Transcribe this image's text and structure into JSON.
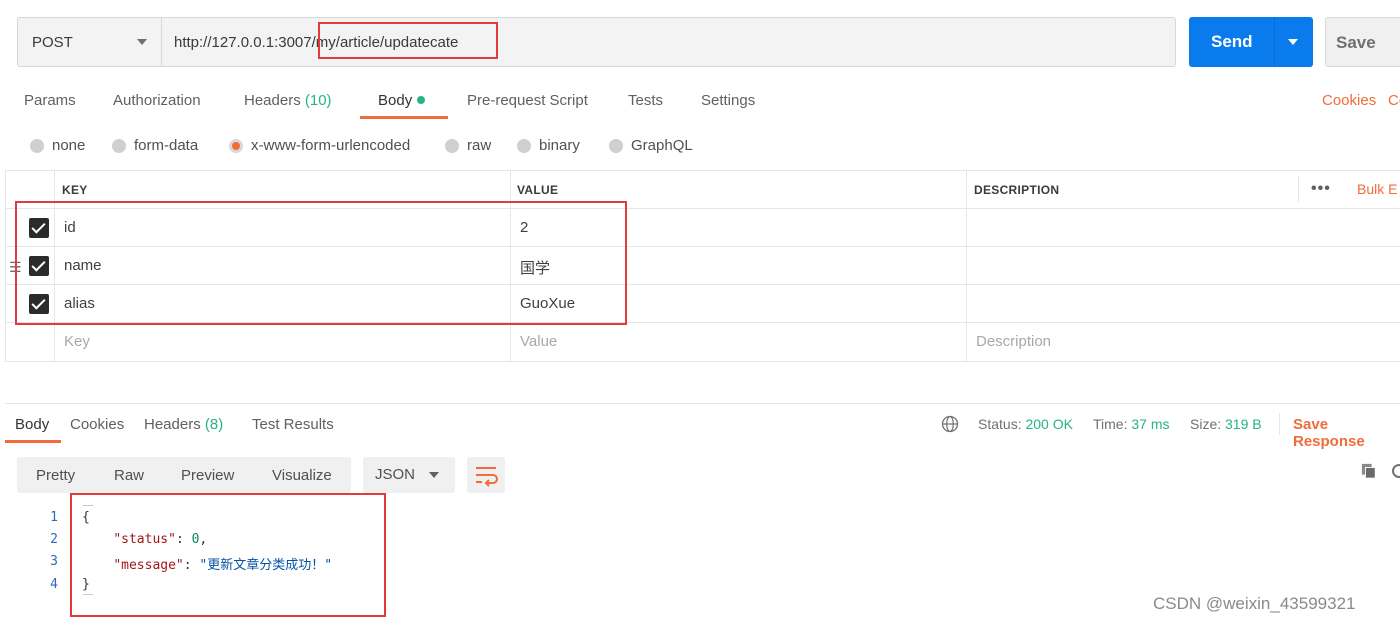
{
  "request": {
    "method": "POST",
    "url": "http://127.0.0.1:3007/my/article/updatecate",
    "send_label": "Send",
    "save_label": "Save"
  },
  "request_tabs": {
    "params": "Params",
    "authorization": "Authorization",
    "headers": "Headers",
    "headers_count": "(10)",
    "body": "Body",
    "prerequest": "Pre-request Script",
    "tests": "Tests",
    "settings": "Settings",
    "cookies": "Cookies",
    "cookies_clipped": "Co"
  },
  "body_types": [
    "none",
    "form-data",
    "x-www-form-urlencoded",
    "raw",
    "binary",
    "GraphQL"
  ],
  "body_type_selected": "x-www-form-urlencoded",
  "params_table": {
    "headers": {
      "key": "KEY",
      "value": "VALUE",
      "description": "DESCRIPTION"
    },
    "bulk_edit": "Bulk E",
    "rows": [
      {
        "key": "id",
        "value": "2",
        "checked": true
      },
      {
        "key": "name",
        "value": "国学",
        "checked": true
      },
      {
        "key": "alias",
        "value": "GuoXue",
        "checked": true
      }
    ],
    "placeholder": {
      "key": "Key",
      "value": "Value",
      "description": "Description"
    }
  },
  "response_tabs": {
    "body": "Body",
    "cookies": "Cookies",
    "headers": "Headers",
    "headers_count": "(8)",
    "test_results": "Test Results"
  },
  "response_status": {
    "status_label": "Status:",
    "status_value": "200 OK",
    "time_label": "Time:",
    "time_value": "37 ms",
    "size_label": "Size:",
    "size_value": "319 B",
    "save_response": "Save Response"
  },
  "response_view": {
    "modes": [
      "Pretty",
      "Raw",
      "Preview",
      "Visualize"
    ],
    "format": "JSON"
  },
  "response_body": {
    "line_numbers": [
      "1",
      "2",
      "3",
      "4"
    ],
    "open_brace": "{",
    "status_key": "\"status\"",
    "status_value": "0",
    "message_key": "\"message\"",
    "message_value": "\"更新文章分类成功！\"",
    "close_brace": "}"
  },
  "watermark": "CSDN @weixin_43599321",
  "colors": {
    "accent_orange": "#f26b3a",
    "send_blue": "#097bed",
    "success_green": "#26b47f",
    "annotation_red": "#e33b3b"
  }
}
